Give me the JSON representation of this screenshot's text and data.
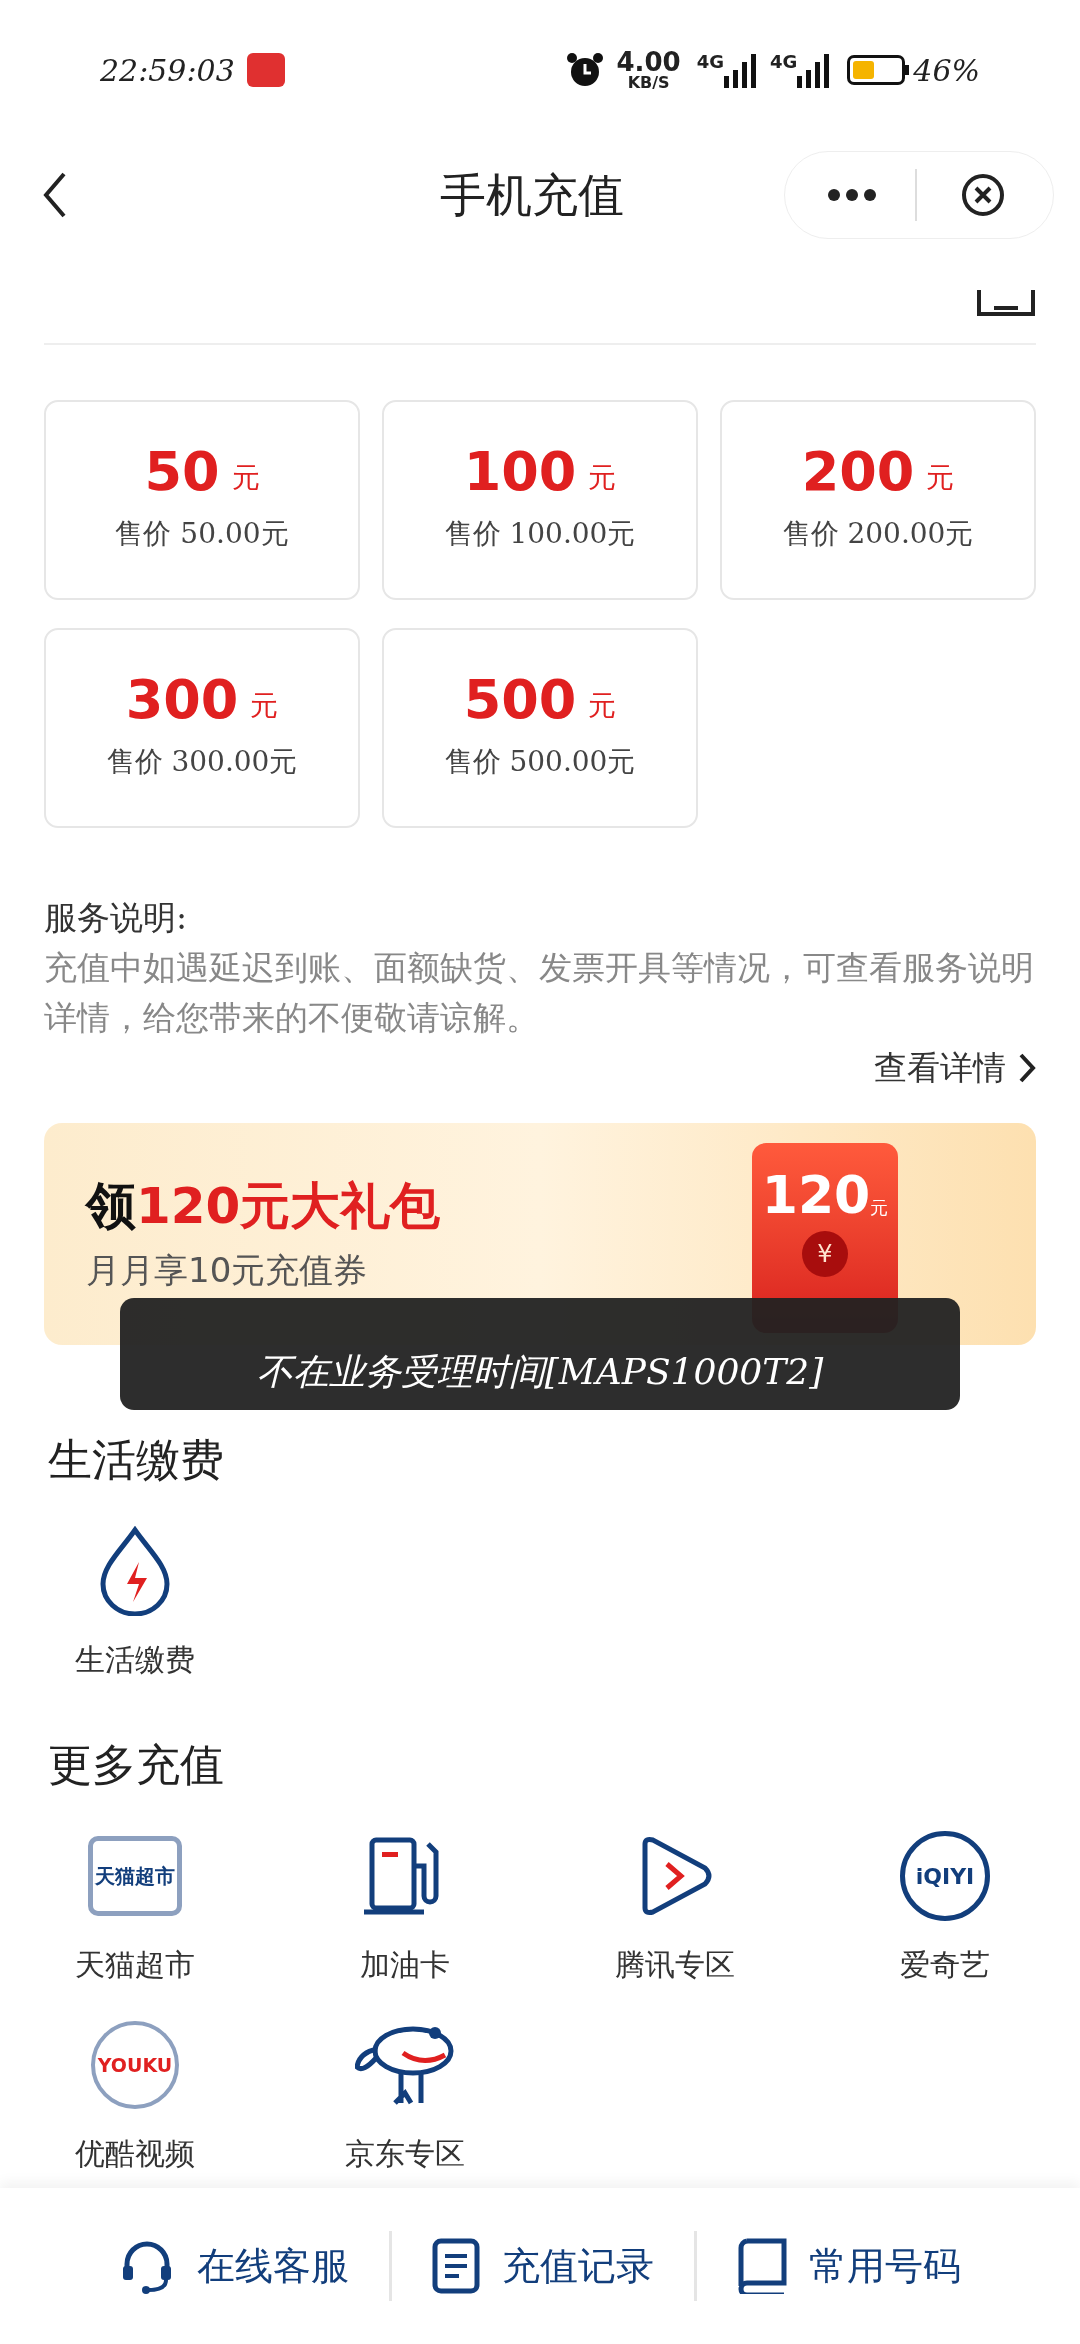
{
  "status_bar": {
    "time": "22:59:03",
    "speed": "4.00",
    "speed_unit": "KB/S",
    "network_1": "4G",
    "network_2": "4G",
    "battery": "46%"
  },
  "header": {
    "title": "手机充值"
  },
  "amounts": [
    {
      "value": "50",
      "unit": "元",
      "price": "售价 50.00元"
    },
    {
      "value": "100",
      "unit": "元",
      "price": "售价 100.00元"
    },
    {
      "value": "200",
      "unit": "元",
      "price": "售价 200.00元"
    },
    {
      "value": "300",
      "unit": "元",
      "price": "售价 300.00元"
    },
    {
      "value": "500",
      "unit": "元",
      "price": "售价 500.00元"
    }
  ],
  "service_note": {
    "title": "服务说明:",
    "body": "充值中如遇延迟到账、面额缺货、发票开具等情况，可查看服务说明详情，给您带来的不便敬请谅解。",
    "link": "查看详情"
  },
  "banner": {
    "title": "领**120元大礼包**",
    "subtitle": "月月享10元充值券",
    "envelope_amount": "120",
    "envelope_unit": "元",
    "envelope_symbol": "¥"
  },
  "toast": {
    "text": "不在业务受理时间[MAPS1000T2]"
  },
  "utilities": {
    "title": "生活缴费",
    "items": [
      {
        "kind": "drop",
        "label": "生活缴费"
      }
    ]
  },
  "more_recharge": {
    "title": "更多充值",
    "items": [
      {
        "kind": "tmall",
        "label": "天猫超市",
        "logo_text": "天猫超市"
      },
      {
        "kind": "fuel",
        "label": "加油卡"
      },
      {
        "kind": "play",
        "label": "腾讯专区"
      },
      {
        "kind": "iqiyi",
        "label": "爱奇艺",
        "logo_text": "iQIYI"
      },
      {
        "kind": "youku",
        "label": "优酷视频",
        "logo_text": "YOUKU"
      },
      {
        "kind": "dog",
        "label": "京东专区"
      }
    ]
  },
  "bottom_bar": [
    {
      "kind": "headset",
      "label": "在线客服"
    },
    {
      "kind": "doc",
      "label": "充值记录"
    },
    {
      "kind": "book",
      "label": "常用号码"
    }
  ]
}
